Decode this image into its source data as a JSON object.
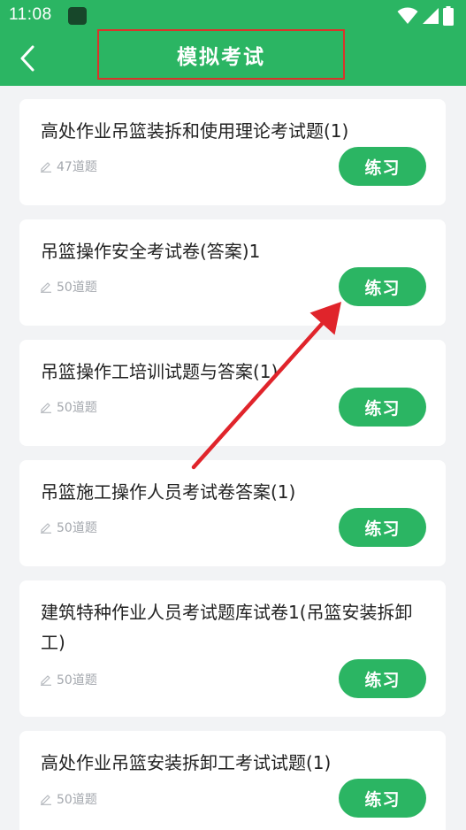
{
  "status_bar": {
    "time": "11:08",
    "icons": [
      "app-icon",
      "wifi-icon",
      "signal-icon",
      "battery-icon"
    ]
  },
  "header": {
    "back_icon": "chevron-left-icon",
    "title": "模拟考试"
  },
  "colors": {
    "brand_green": "#2bb563",
    "annotation_red": "#e0242b",
    "background": "#f2f3f5"
  },
  "exams": [
    {
      "title": "高处作业吊篮装拆和使用理论考试题(1)",
      "count": "47道题",
      "button": "练习"
    },
    {
      "title": "吊篮操作安全考试卷(答案)1",
      "count": "50道题",
      "button": "练习"
    },
    {
      "title": "吊篮操作工培训试题与答案(1)",
      "count": "50道题",
      "button": "练习"
    },
    {
      "title": "吊篮施工操作人员考试卷答案(1)",
      "count": "50道题",
      "button": "练习"
    },
    {
      "title": "建筑特种作业人员考试题库试卷1(吊篮安装拆卸工)",
      "count": "50道题",
      "button": "练习"
    },
    {
      "title": "高处作业吊篮安装拆卸工考试试题(1)",
      "count": "50道题",
      "button": "练习"
    }
  ]
}
